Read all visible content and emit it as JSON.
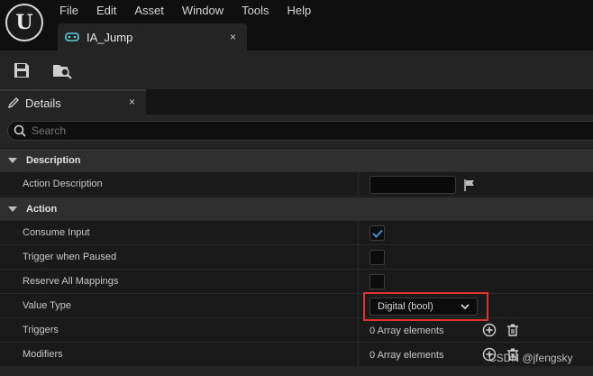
{
  "menu": [
    "File",
    "Edit",
    "Asset",
    "Window",
    "Tools",
    "Help"
  ],
  "document_tab": {
    "label": "IA_Jump",
    "close": "×"
  },
  "details_tab": {
    "label": "Details",
    "close": "×"
  },
  "search": {
    "placeholder": "Search"
  },
  "categories": {
    "description": "Description",
    "action": "Action"
  },
  "rows": {
    "action_description": {
      "label": "Action Description",
      "value": ""
    },
    "consume_input": {
      "label": "Consume Input",
      "checked": true
    },
    "trigger_when_paused": {
      "label": "Trigger when Paused",
      "checked": false
    },
    "reserve_all_mappings": {
      "label": "Reserve All Mappings",
      "checked": false
    },
    "value_type": {
      "label": "Value Type",
      "value": "Digital (bool)"
    },
    "triggers": {
      "label": "Triggers",
      "value": "0 Array elements"
    },
    "modifiers": {
      "label": "Modifiers",
      "value": "0 Array elements"
    }
  },
  "watermark": "CSDN @jfengsky",
  "colors": {
    "accent": "#3d8fd6",
    "highlight": "#e0332f",
    "tab_icon": "#5ad1e0"
  }
}
